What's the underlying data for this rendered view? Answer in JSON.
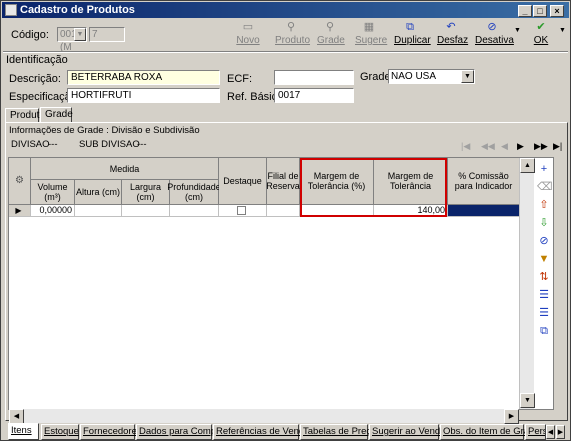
{
  "window": {
    "title": "Cadastro de Produtos"
  },
  "toolbar": {
    "codigo_label": "Código:",
    "codigo_value": "001 (M",
    "codigo_suffix": "7",
    "buttons": [
      {
        "label": "Novo",
        "enabled": false,
        "icon": "new-document-icon"
      },
      {
        "label": "Produto",
        "enabled": false,
        "icon": "search-product-icon"
      },
      {
        "label": "Grade",
        "enabled": false,
        "icon": "search-grade-icon"
      },
      {
        "label": "Sugere",
        "enabled": false,
        "icon": "suggest-icon"
      },
      {
        "label": "Duplicar",
        "enabled": true,
        "icon": "duplicate-icon"
      },
      {
        "label": "Desfaz",
        "enabled": true,
        "icon": "undo-icon"
      },
      {
        "label": "Desativa",
        "enabled": true,
        "icon": "deactivate-icon"
      },
      {
        "label": "OK",
        "enabled": true,
        "icon": "check-icon"
      }
    ]
  },
  "identificacao": {
    "title": "Identificação",
    "descricao_label": "Descrição:",
    "descricao_value": "BETERRABA ROXA",
    "ecf_label": "ECF:",
    "ecf_value": "",
    "grade_label": "Grade:",
    "grade_value": "NAO USA",
    "especificacao_label": "Especificação:",
    "especificacao_value": "HORTIFRUTI",
    "ref_label": "Ref. Básica:",
    "ref_value": "0017"
  },
  "tabs": [
    "Produto",
    "Grade"
  ],
  "grade_panel": {
    "info_title": "Informações de Grade : Divisão e Subdivisão",
    "divisao_label": "DIVISAO",
    "divisao_value": "---",
    "subdivisao_label": "SUB DIVISAO",
    "subdivisao_value": "---"
  },
  "grid": {
    "group_header": "Medida",
    "columns": [
      "Volume (m³)",
      "Altura (cm)",
      "Largura (cm)",
      "Profundidade (cm)",
      "Destaque",
      "Filial de Reserva",
      "Margem de Tolerância (%)",
      "Margem de Tolerância",
      "% Comissão para Indicador"
    ],
    "rows": [
      {
        "volume": "0,00000",
        "altura": "",
        "largura": "",
        "profundidade": "",
        "destaque": false,
        "filial": "",
        "margem_pct": "",
        "margem": "140,00",
        "comissao": ""
      }
    ]
  },
  "bottom_tabs": [
    "Itens",
    "Estoque",
    "Fornecedores",
    "Dados para Compra",
    "Referências de Venda",
    "Tabelas de Preço",
    "Sugerir ao Vender",
    "Obs. do Item de Grade",
    "Pers"
  ],
  "colors": {
    "title_bar": "#0a246a",
    "highlight": "#d00000",
    "selection": "#0a246a"
  }
}
